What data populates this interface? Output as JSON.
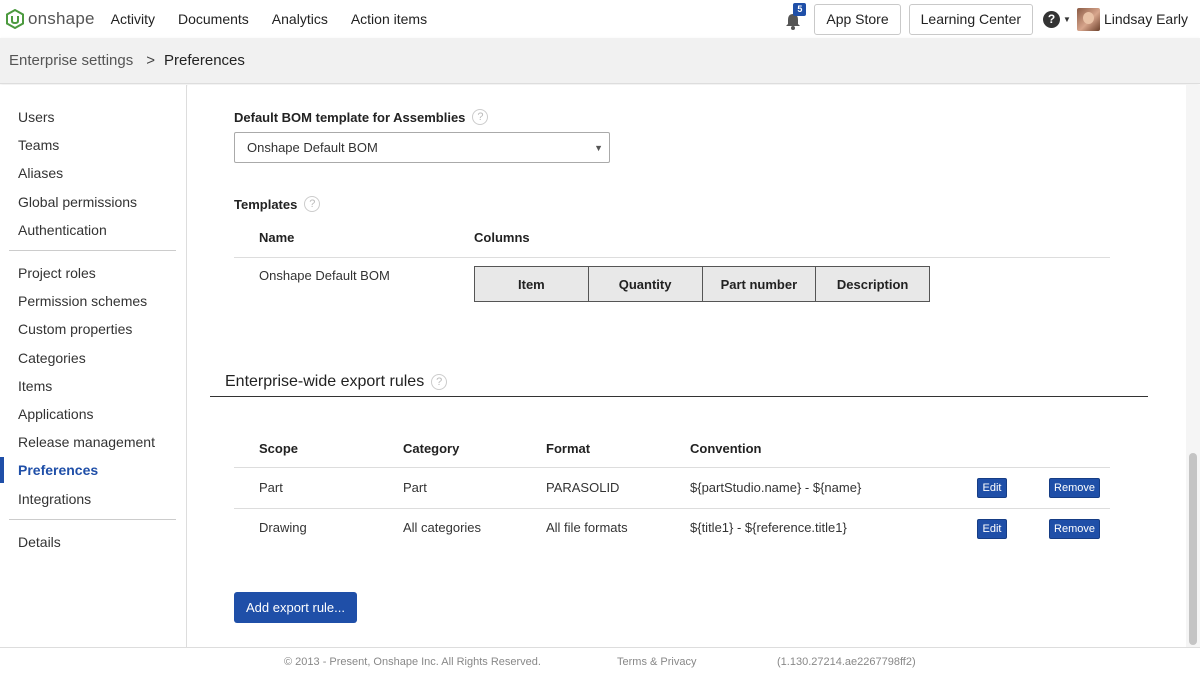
{
  "app": {
    "logo_text": "onshape",
    "nav_links": [
      "Activity",
      "Documents",
      "Analytics",
      "Action items"
    ],
    "notification_count": "5",
    "app_store_label": "App Store",
    "learning_center_label": "Learning Center",
    "user_name": "Lindsay Early",
    "brand_color": "#1f4fa8",
    "logo_color": "#4c9a3f"
  },
  "breadcrumb": {
    "parent": "Enterprise settings",
    "separator": ">",
    "current": "Preferences"
  },
  "sidebar": {
    "groups": [
      [
        "Users",
        "Teams",
        "Aliases",
        "Global permissions",
        "Authentication"
      ],
      [
        "Project roles",
        "Permission schemes",
        "Custom properties",
        "Categories",
        "Items",
        "Applications",
        "Release management",
        "Preferences",
        "Integrations"
      ],
      [
        "Details"
      ]
    ],
    "active": "Preferences"
  },
  "bom": {
    "label": "Default BOM template for Assemblies",
    "help": "?",
    "selected": "Onshape Default BOM",
    "templates_label": "Templates",
    "templates_headers": {
      "name": "Name",
      "columns": "Columns"
    },
    "templates": [
      {
        "name": "Onshape Default BOM",
        "columns": [
          "Item",
          "Quantity",
          "Part number",
          "Description"
        ]
      }
    ]
  },
  "export_rules": {
    "title": "Enterprise-wide export rules",
    "help": "?",
    "headers": {
      "scope": "Scope",
      "category": "Category",
      "format": "Format",
      "convention": "Convention"
    },
    "rows": [
      {
        "scope": "Part",
        "category": "Part",
        "format": "PARASOLID",
        "convention": "${partStudio.name} - ${name}"
      },
      {
        "scope": "Drawing",
        "category": "All categories",
        "format": "All file formats",
        "convention": "${title1} - ${reference.title1}"
      }
    ],
    "edit_label": "Edit",
    "remove_label": "Remove",
    "add_label": "Add export rule..."
  },
  "footer": {
    "copyright": "© 2013 - Present, Onshape Inc. All Rights Reserved.",
    "terms": "Terms & Privacy",
    "version": "(1.130.27214.ae2267798ff2)"
  }
}
